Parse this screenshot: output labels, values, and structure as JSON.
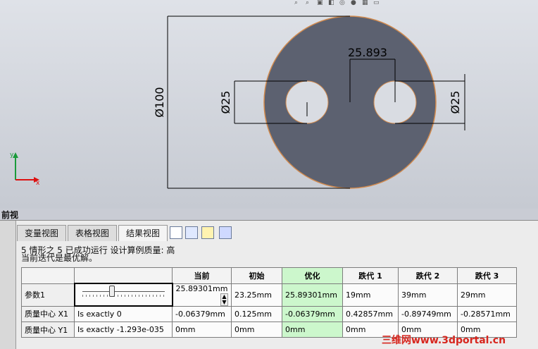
{
  "toolbar_icons": [
    "zoom-icon",
    "zoom-area-icon",
    "view-orientation-icon",
    "display-style-icon",
    "hide-show-icon",
    "appearance-icon",
    "scene-icon",
    "view-settings-icon"
  ],
  "drawing": {
    "dims": {
      "diameter_outer": "Ø100",
      "spacing": "25.893",
      "diameter_left": "Ø25",
      "diameter_right": "Ø25"
    }
  },
  "view_label": "前视",
  "tabs": [
    {
      "label": "变量视图"
    },
    {
      "label": "表格视图"
    },
    {
      "label": "结果视图",
      "active": true
    }
  ],
  "status": {
    "line1": "5 情形之 5 已成功运行 设计算例质量: 高",
    "line2": "当前迭代是最优解。"
  },
  "table": {
    "headers": [
      "当前",
      "初始",
      "优化",
      "跌代 1",
      "跌代 2",
      "跌代 3"
    ],
    "rows": [
      {
        "label": "参数1",
        "col0": "",
        "values": [
          "25.89301mm",
          "23.25mm",
          "25.89301mm",
          "19mm",
          "39mm",
          "29mm"
        ]
      },
      {
        "label": "质量中心 X1",
        "col0": "Is exactly 0",
        "values": [
          "-0.06379mm",
          "0.125mm",
          "-0.06379mm",
          "0.42857mm",
          "-0.89749mm",
          "-0.28571mm"
        ]
      },
      {
        "label": "质量中心 Y1",
        "col0": "Is exactly -1.293e-035",
        "values": [
          "0mm",
          "0mm",
          "0mm",
          "0mm",
          "0mm",
          "0mm"
        ]
      }
    ]
  },
  "watermark": "三维网www.3dportal.cn"
}
